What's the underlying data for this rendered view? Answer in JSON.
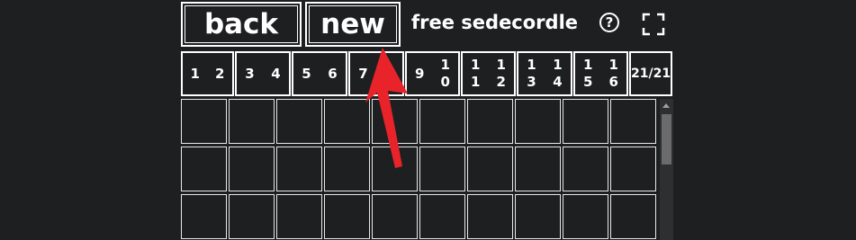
{
  "toolbar": {
    "back_label": "back",
    "new_label": "new",
    "title": "free sedecordle",
    "help_label": "?"
  },
  "boards": {
    "groups": [
      [
        "1",
        "2"
      ],
      [
        "3",
        "4"
      ],
      [
        "5",
        "6"
      ],
      [
        "7",
        "8"
      ],
      [
        "9",
        "10"
      ],
      [
        "11",
        "12"
      ],
      [
        "13",
        "14"
      ],
      [
        "15",
        "16"
      ]
    ],
    "counter": "21/21"
  },
  "icons": {
    "help": "help-icon",
    "fullscreen": "fullscreen-icon",
    "annotation": "red-arrow-annotation"
  },
  "colors": {
    "background": "#1e1f21",
    "foreground": "#ffffff",
    "annotation": "#e8232a"
  },
  "grid": {
    "columns": 10,
    "visible_rows": 3
  }
}
